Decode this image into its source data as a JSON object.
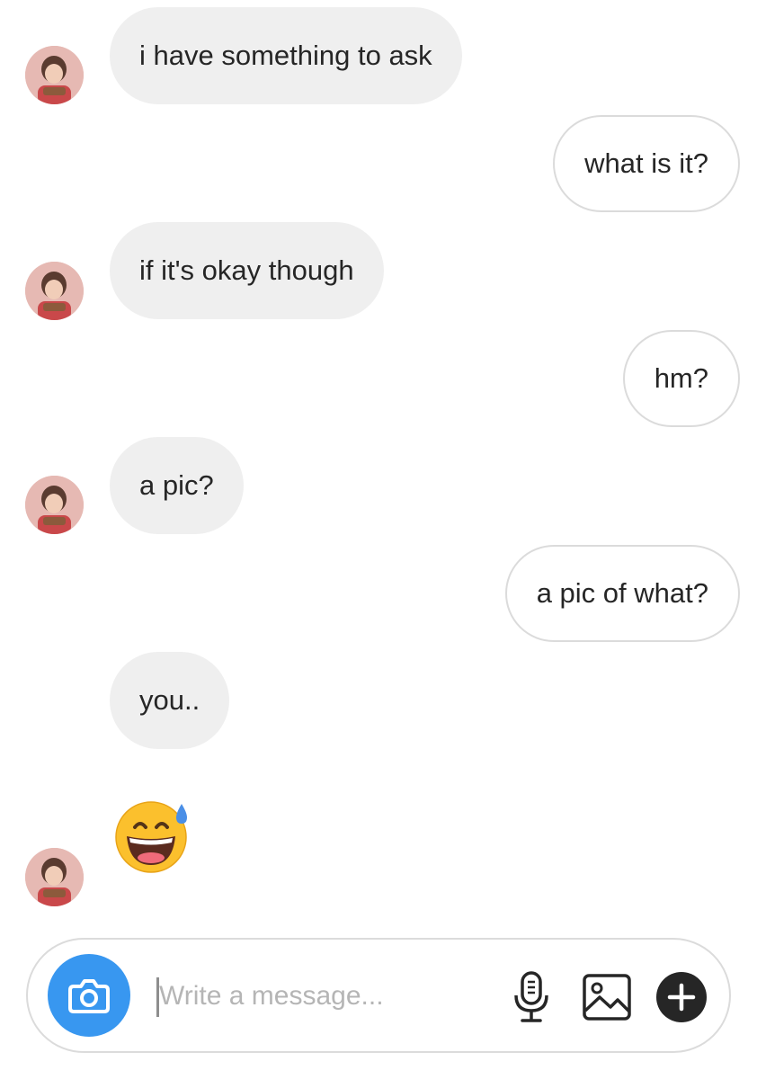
{
  "conversation": {
    "messages": [
      {
        "sender": "them",
        "text": "i have something to ask"
      },
      {
        "sender": "me",
        "text": "what is it?"
      },
      {
        "sender": "them",
        "text": "if it's okay though"
      },
      {
        "sender": "me",
        "text": "hm?"
      },
      {
        "sender": "them",
        "text": "a pic?"
      },
      {
        "sender": "me",
        "text": "a pic of what?"
      },
      {
        "sender": "them",
        "text": "you.."
      },
      {
        "sender": "them",
        "type": "emoji",
        "emoji_name": "grinning-face-with-sweat"
      }
    ]
  },
  "composer": {
    "placeholder": "Write a message...",
    "value": "",
    "icons": [
      "camera-icon",
      "microphone-icon",
      "image-gallery-icon",
      "plus-icon"
    ]
  },
  "colors": {
    "incoming_bubble": "#efefef",
    "outgoing_border": "#dbdbdb",
    "camera_button": "#3897f0",
    "plus_button": "#262626",
    "emoji_face": "#fbc02d",
    "emoji_sweat": "#4a8fe7"
  }
}
